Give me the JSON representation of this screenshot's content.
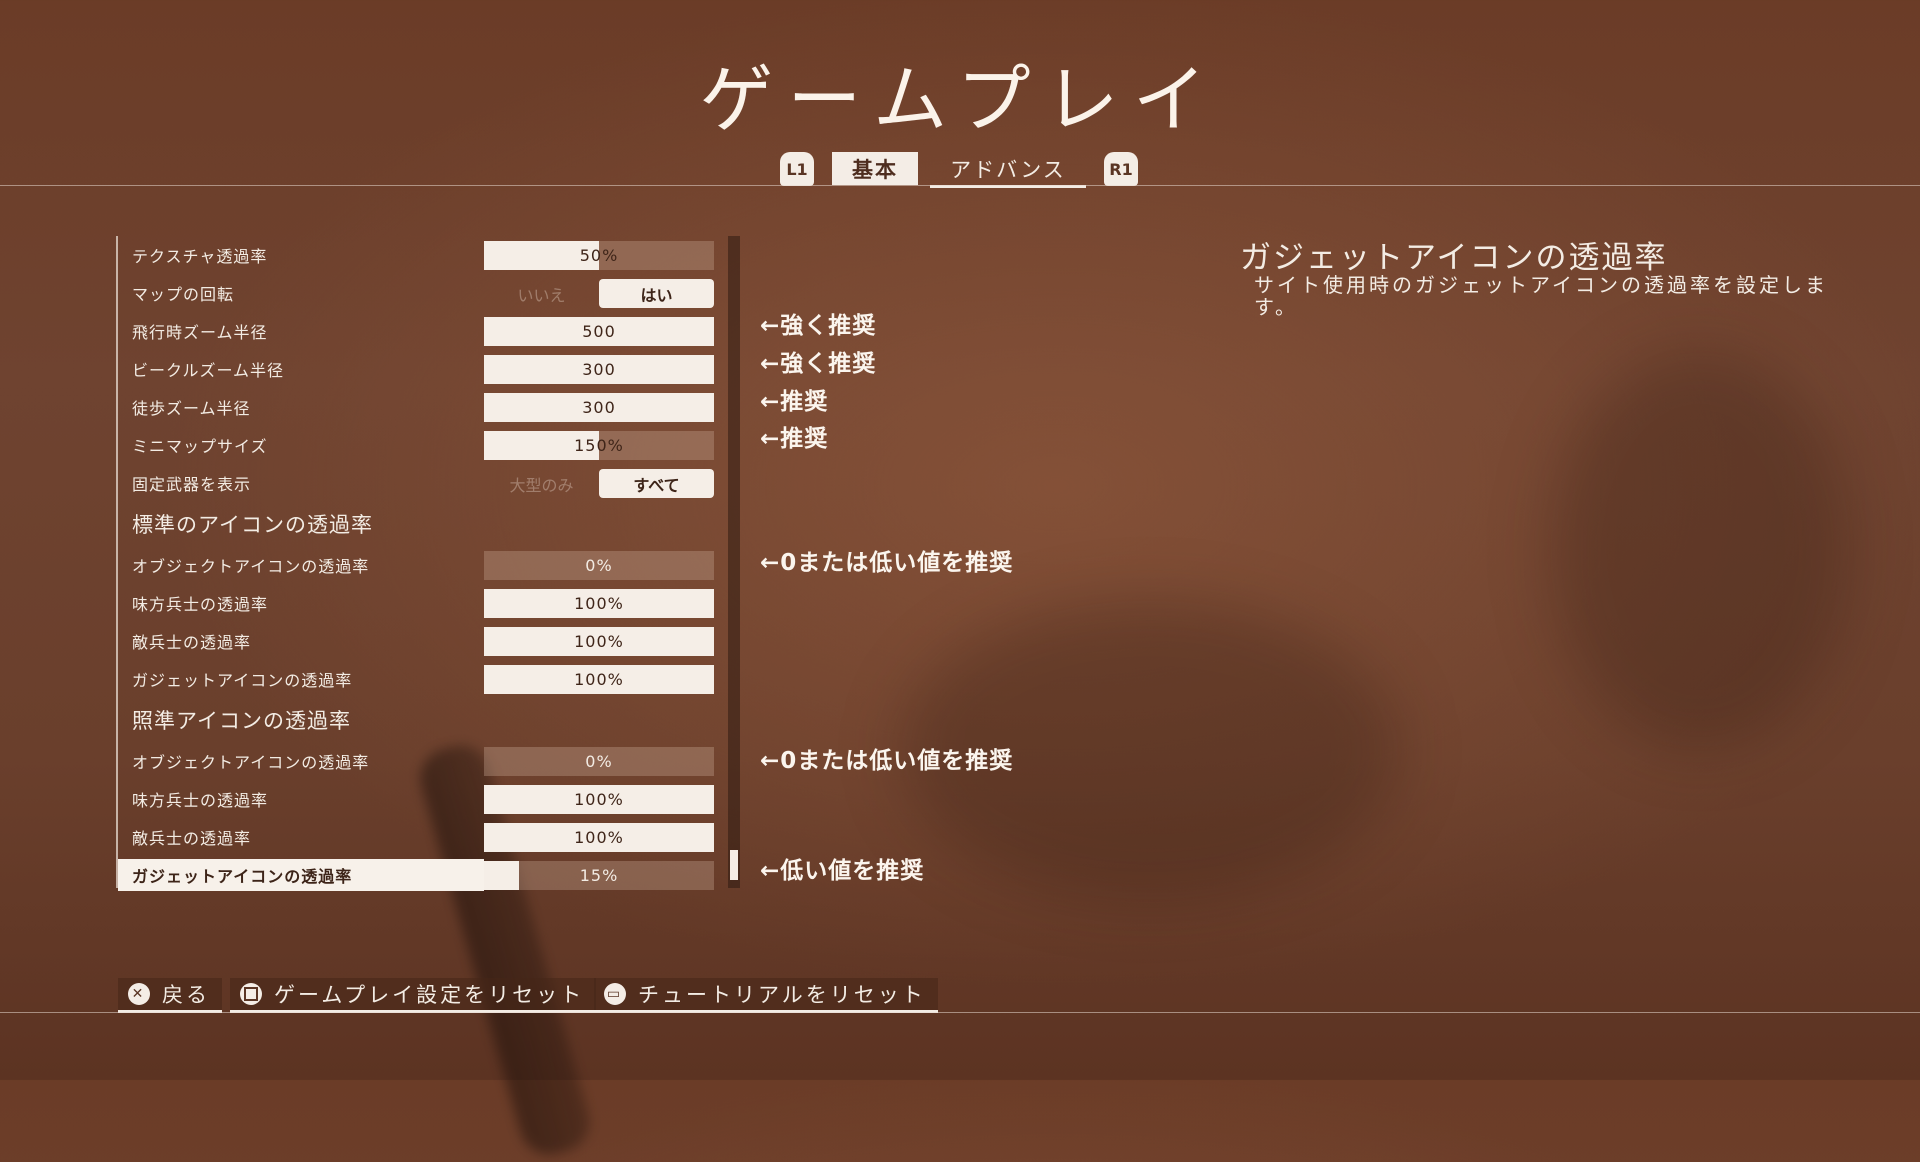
{
  "title": "ゲームプレイ",
  "tabs": {
    "left_bumper": "L1",
    "right_bumper": "R1",
    "items": [
      {
        "label": "基本",
        "active": true
      },
      {
        "label": "アドバンス",
        "active": false
      }
    ]
  },
  "settings": [
    {
      "label": "テクスチャ透過率",
      "type": "slider",
      "value": "50%",
      "fill": 0.5
    },
    {
      "label": "マップの回転",
      "type": "toggle",
      "off": "いいえ",
      "on": "はい"
    },
    {
      "label": "飛行時ズーム半径",
      "type": "slider",
      "value": "500",
      "fill": 1.0
    },
    {
      "label": "ビークルズーム半径",
      "type": "slider",
      "value": "300",
      "fill": 1.0
    },
    {
      "label": "徒歩ズーム半径",
      "type": "slider",
      "value": "300",
      "fill": 1.0
    },
    {
      "label": "ミニマップサイズ",
      "type": "slider",
      "value": "150%",
      "fill": 0.5
    },
    {
      "label": "固定武器を表示",
      "type": "toggle",
      "off": "大型のみ",
      "on": "すべて"
    }
  ],
  "sections": [
    {
      "title": "標準のアイコンの透過率",
      "rows": [
        {
          "label": "オブジェクトアイコンの透過率",
          "value": "0%",
          "fill": 0.0
        },
        {
          "label": "味方兵士の透過率",
          "value": "100%",
          "fill": 1.0
        },
        {
          "label": "敵兵士の透過率",
          "value": "100%",
          "fill": 1.0
        },
        {
          "label": "ガジェットアイコンの透過率",
          "value": "100%",
          "fill": 1.0
        }
      ]
    },
    {
      "title": "照準アイコンの透過率",
      "rows": [
        {
          "label": "オブジェクトアイコンの透過率",
          "value": "0%",
          "fill": 0.0
        },
        {
          "label": "味方兵士の透過率",
          "value": "100%",
          "fill": 1.0
        },
        {
          "label": "敵兵士の透過率",
          "value": "100%",
          "fill": 1.0
        },
        {
          "label": "ガジェットアイコンの透過率",
          "value": "15%",
          "fill": 0.15,
          "selected": true
        }
      ]
    }
  ],
  "notes": {
    "strong1": "←強く推奨",
    "strong2": "←強く推奨",
    "rec1": "←推奨",
    "rec2": "←推奨",
    "zero1": "←0または低い値を推奨",
    "zero2": "←0または低い値を推奨",
    "low": "←低い値を推奨"
  },
  "description": {
    "title": "ガジェットアイコンの透過率",
    "text": "サイト使用時のガジェットアイコンの透過率を設定します。"
  },
  "footer": {
    "back": "戻る",
    "reset_gameplay": "ゲームプレイ設定をリセット",
    "reset_tutorial": "チュートリアルをリセット"
  }
}
